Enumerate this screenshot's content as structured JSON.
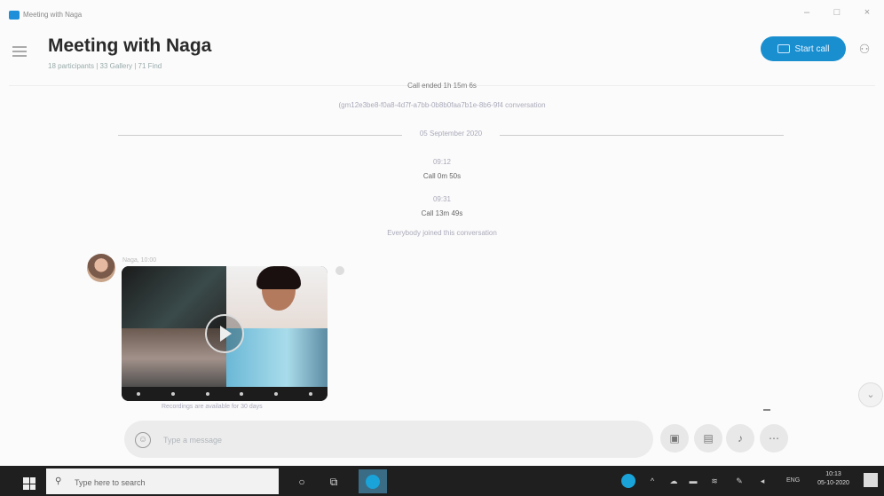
{
  "window": {
    "title": "Meeting with Naga",
    "controls": {
      "minimize": "–",
      "maximize": "□",
      "close": "×"
    }
  },
  "header": {
    "chat_title": "Meeting with Naga",
    "subtitle": "18 participants | 33 Gallery | 71 Find",
    "start_call_label": "Start call",
    "add_person_icon": "add-person-icon"
  },
  "messages": {
    "call_ended": "Call ended 1h 15m 6s",
    "call_link": "(gm12e3be8-f0a8-4d7f-a7bb-0b8b0faa7b1e-8b6-9f4 conversation",
    "date_separator": "05 September 2020",
    "call_1_time": "09:12",
    "call_1_text": "Call 0m 50s",
    "call_2_time": "09:31",
    "call_2_text": "Call 13m 49s",
    "rejoin_note": "Everybody joined this conversation",
    "sender": "Naga, 10:00",
    "video_caption": "Recordings are available for 30 days"
  },
  "composer": {
    "placeholder": "Type a message"
  },
  "taskbar": {
    "search_placeholder": "Type here to search",
    "language": "ENG",
    "time": "10:13",
    "date": "05-10-2020"
  },
  "colors": {
    "accent": "#1a8fd0",
    "taskbar": "#1f1f1f",
    "background": "#fbfbfb"
  }
}
